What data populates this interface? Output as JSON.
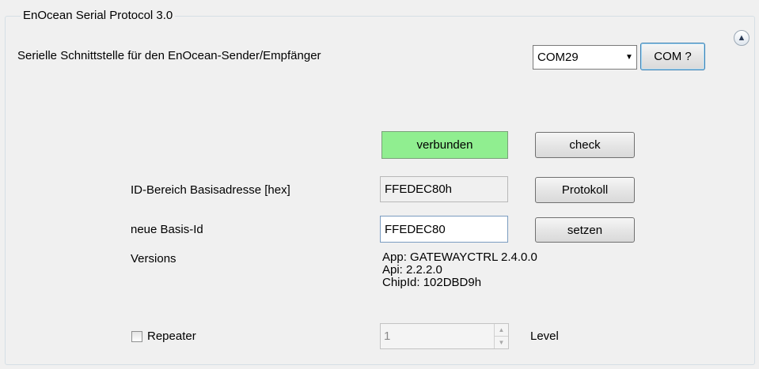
{
  "group": {
    "title": "EnOcean Serial Protocol 3.0"
  },
  "serial": {
    "label": "Serielle Schnittstelle für den EnOcean-Sender/Empfänger",
    "port_value": "COM29",
    "com_button": "COM ?"
  },
  "status": {
    "text": "verbunden",
    "check_button": "check",
    "color": "#90ee90"
  },
  "id_range": {
    "label": "ID-Bereich Basisadresse [hex]",
    "value": "FFEDEC80h",
    "protokoll_button": "Protokoll"
  },
  "base_id": {
    "label": "neue Basis-Id",
    "value": "FFEDEC80",
    "setzen_button": "setzen"
  },
  "versions": {
    "label": "Versions",
    "app": "App:  GATEWAYCTRL  2.4.0.0",
    "api": "Api:  2.2.2.0",
    "chip": "ChipId: 102DBD9h"
  },
  "repeater": {
    "label": "Repeater",
    "checked": false,
    "level_value": "1",
    "level_label": "Level"
  },
  "icons": {
    "collapse": "chevron-double-up-icon",
    "dropdown": "chevron-down-icon"
  }
}
